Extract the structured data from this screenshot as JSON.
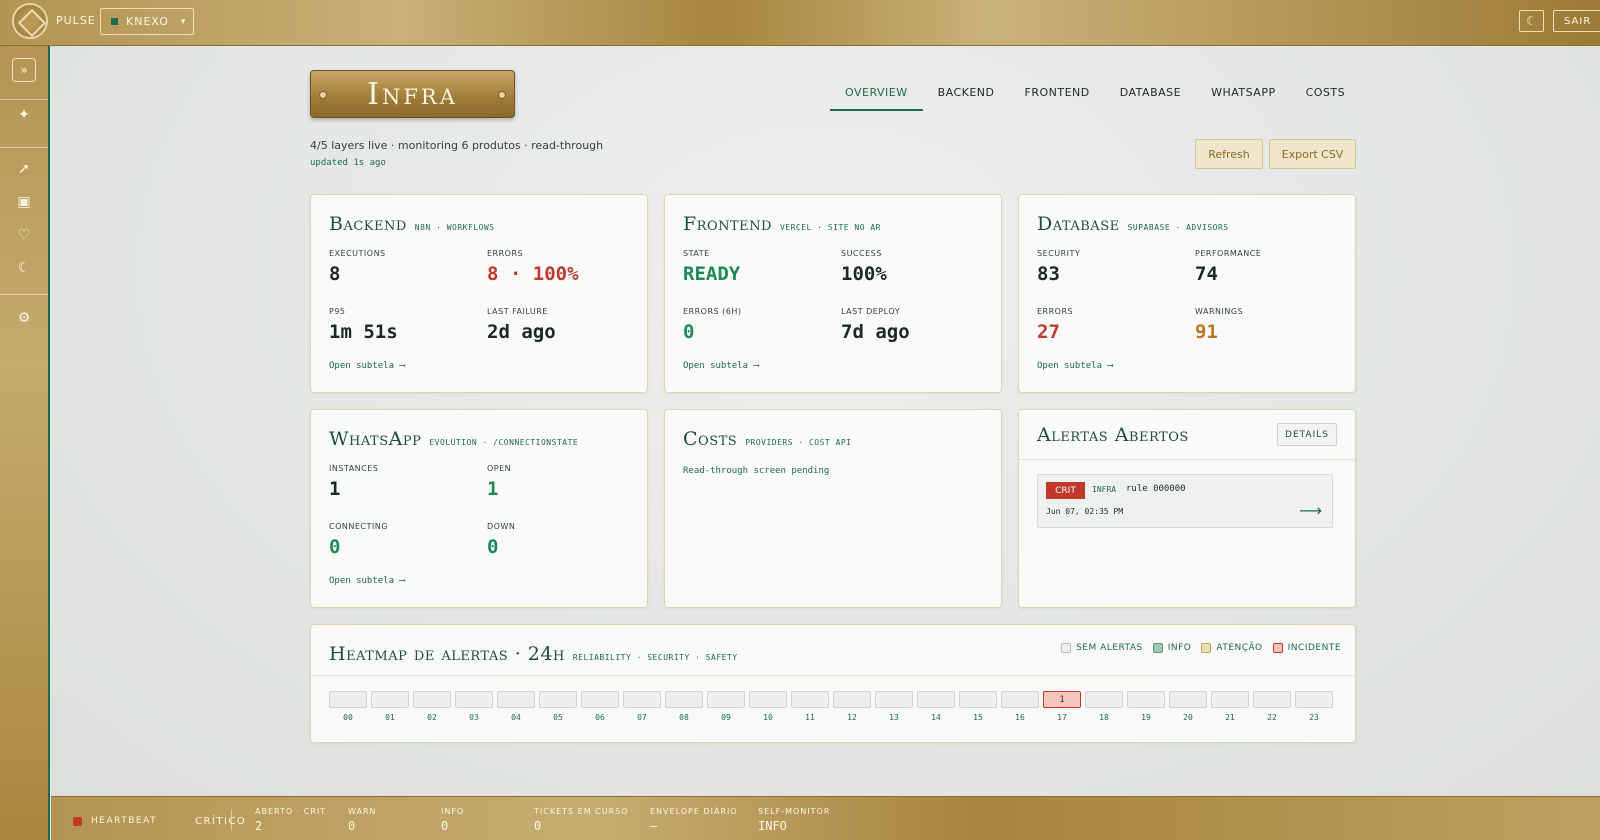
{
  "topbar": {
    "brand": "PULSE",
    "tenant": "KNEXO",
    "tenant_caret": "▾",
    "theme_icon": "☾",
    "logout_label": "SAIR"
  },
  "sidebar": {
    "toggle_icon": "»",
    "items": [
      {
        "name": "sparkle-icon",
        "glyph": "✦"
      },
      {
        "name": "rocket-icon",
        "glyph": "➚"
      },
      {
        "name": "chip-icon",
        "glyph": "▣"
      },
      {
        "name": "heart-icon",
        "glyph": "♡"
      },
      {
        "name": "moon-gear-icon",
        "glyph": "☾"
      },
      {
        "name": "settings-icon",
        "glyph": "⚙"
      }
    ]
  },
  "header": {
    "title": "Infra",
    "subtitle": "4/5 layers live · monitoring 6 produtos · read-through",
    "updated": "updated 1s ago",
    "tabs": [
      "OVERVIEW",
      "BACKEND",
      "FRONTEND",
      "DATABASE",
      "WHATSAPP",
      "COSTS"
    ],
    "active_tab": "OVERVIEW",
    "refresh_label": "Refresh",
    "export_label": "Export CSV"
  },
  "cards": {
    "backend": {
      "title": "Backend",
      "sub": "N8N · WORKFLOWS",
      "m1_label": "EXECUTIONS",
      "m1_value": "8",
      "m2_label": "ERRORS",
      "m2_value": "8 · 100%",
      "m3_label": "P95",
      "m3_value": "1m 51s",
      "m4_label": "LAST FAILURE",
      "m4_value": "2d ago",
      "link": "Open subtela ⟶"
    },
    "frontend": {
      "title": "Frontend",
      "sub": "VERCEL · SITE NO AR",
      "m1_label": "STATE",
      "m1_value": "READY",
      "m2_label": "SUCCESS",
      "m2_value": "100%",
      "m3_label": "ERRORS (6H)",
      "m3_value": "0",
      "m4_label": "LAST DEPLOY",
      "m4_value": "7d ago",
      "link": "Open subtela ⟶"
    },
    "database": {
      "title": "Database",
      "sub": "SUPABASE · ADVISORS",
      "m1_label": "SECURITY",
      "m1_value": "83",
      "m2_label": "PERFORMANCE",
      "m2_value": "74",
      "m3_label": "ERRORS",
      "m3_value": "27",
      "m4_label": "WARNINGS",
      "m4_value": "91",
      "link": "Open subtela ⟶"
    },
    "whatsapp": {
      "title": "WhatsApp",
      "sub": "EVOLUTION · /CONNECTIONSTATE",
      "m1_label": "INSTANCES",
      "m1_value": "1",
      "m2_label": "OPEN",
      "m2_value": "1",
      "m3_label": "CONNECTING",
      "m3_value": "0",
      "m4_label": "DOWN",
      "m4_value": "0",
      "link": "Open subtela ⟶"
    },
    "costs": {
      "title": "Costs",
      "sub": "PROVIDERS · COST API",
      "pending": "Read-through screen pending"
    },
    "alerts": {
      "title": "Alertas Abertos",
      "details_label": "DETAILS",
      "items": [
        {
          "severity": "CRIT",
          "layer": "INFRA",
          "rule": "rule 000000",
          "time": "Jun 07, 02:35 PM",
          "arrow": "⟶"
        }
      ]
    }
  },
  "heatmap": {
    "title": "Heatmap de alertas · 24h",
    "sub": "RELIABILITY · SECURITY · SAFETY",
    "legend": [
      {
        "label": "SEM ALERTAS",
        "color": "#eeefed"
      },
      {
        "label": "INFO",
        "color": "#9cc9b4"
      },
      {
        "label": "ATENÇÃO",
        "color": "#eadfb0"
      },
      {
        "label": "INCIDENTE",
        "color": "#f3c6bd"
      }
    ],
    "hours": [
      "00",
      "01",
      "02",
      "03",
      "04",
      "05",
      "06",
      "07",
      "08",
      "09",
      "10",
      "11",
      "12",
      "13",
      "14",
      "15",
      "16",
      "17",
      "18",
      "19",
      "20",
      "21",
      "22",
      "23"
    ],
    "counts": [
      0,
      0,
      0,
      0,
      0,
      0,
      0,
      0,
      0,
      0,
      0,
      0,
      0,
      0,
      0,
      0,
      0,
      1,
      0,
      0,
      0,
      0,
      0,
      0
    ]
  },
  "footer": {
    "heartbeat_label": "HEARTBEAT",
    "heartbeat_status": "CRÍTICO",
    "stats": [
      {
        "label": "ABERTO · CRIT",
        "value": "2"
      },
      {
        "label": "WARN",
        "value": "0"
      },
      {
        "label": "INFO",
        "value": "0"
      },
      {
        "label": "TICKETS EM CURSO",
        "value": "0"
      },
      {
        "label": "ENVELOPE DIÁRIO",
        "value": "—"
      },
      {
        "label": "SELF-MONITOR",
        "value": "INFO"
      }
    ]
  },
  "colors": {
    "accent": "#1f6a4a",
    "gold": "#b39451",
    "crit": "#c0392b",
    "ok": "#1e8a55",
    "warn": "#b7791f"
  }
}
